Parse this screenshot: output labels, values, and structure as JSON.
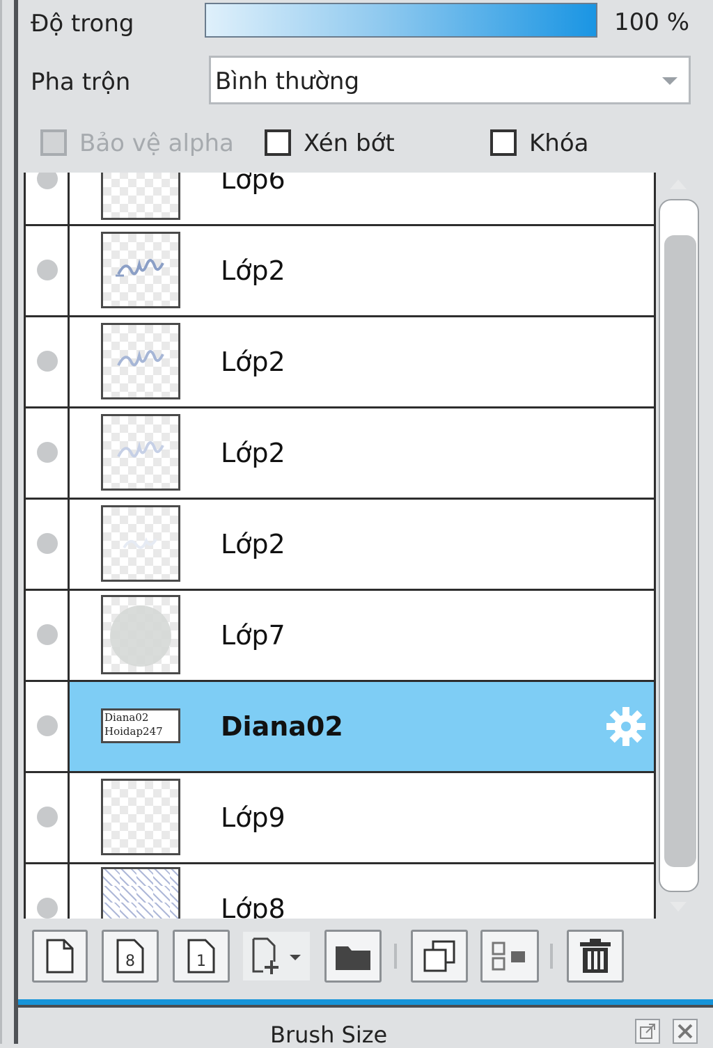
{
  "properties": {
    "opacity_label": "Độ trong",
    "opacity_value": "100 %",
    "opacity_fraction": 1.0,
    "blend_label": "Pha trộn",
    "blend_value": "Bình thường",
    "protect_alpha_label": "Bảo vệ alpha",
    "protect_alpha_checked": false,
    "protect_alpha_disabled": true,
    "clip_label": "Xén bớt",
    "clip_checked": false,
    "lock_label": "Khóa",
    "lock_checked": false
  },
  "layers": [
    {
      "name": "Lớp6"
    },
    {
      "name": "Lớp2"
    },
    {
      "name": "Lớp2"
    },
    {
      "name": "Lớp2"
    },
    {
      "name": "Lớp2"
    },
    {
      "name": "Lớp7"
    },
    {
      "name": "Diana02",
      "selected": true,
      "thumb_text": [
        "Diana02",
        "Hoidap247"
      ]
    },
    {
      "name": "Lớp9"
    },
    {
      "name": "Lớp8"
    }
  ],
  "toolbar": {
    "icons": [
      "new-layer-icon",
      "new-8bit-layer-icon",
      "new-1bit-layer-icon",
      "add-layer-menu-icon",
      "new-folder-icon",
      "duplicate-layer-icon",
      "merge-down-icon",
      "delete-layer-icon"
    ]
  },
  "bottom_panel": {
    "title": "Brush Size"
  },
  "colors": {
    "selected_row": "#7ecdf5",
    "accent": "#1694d9"
  }
}
